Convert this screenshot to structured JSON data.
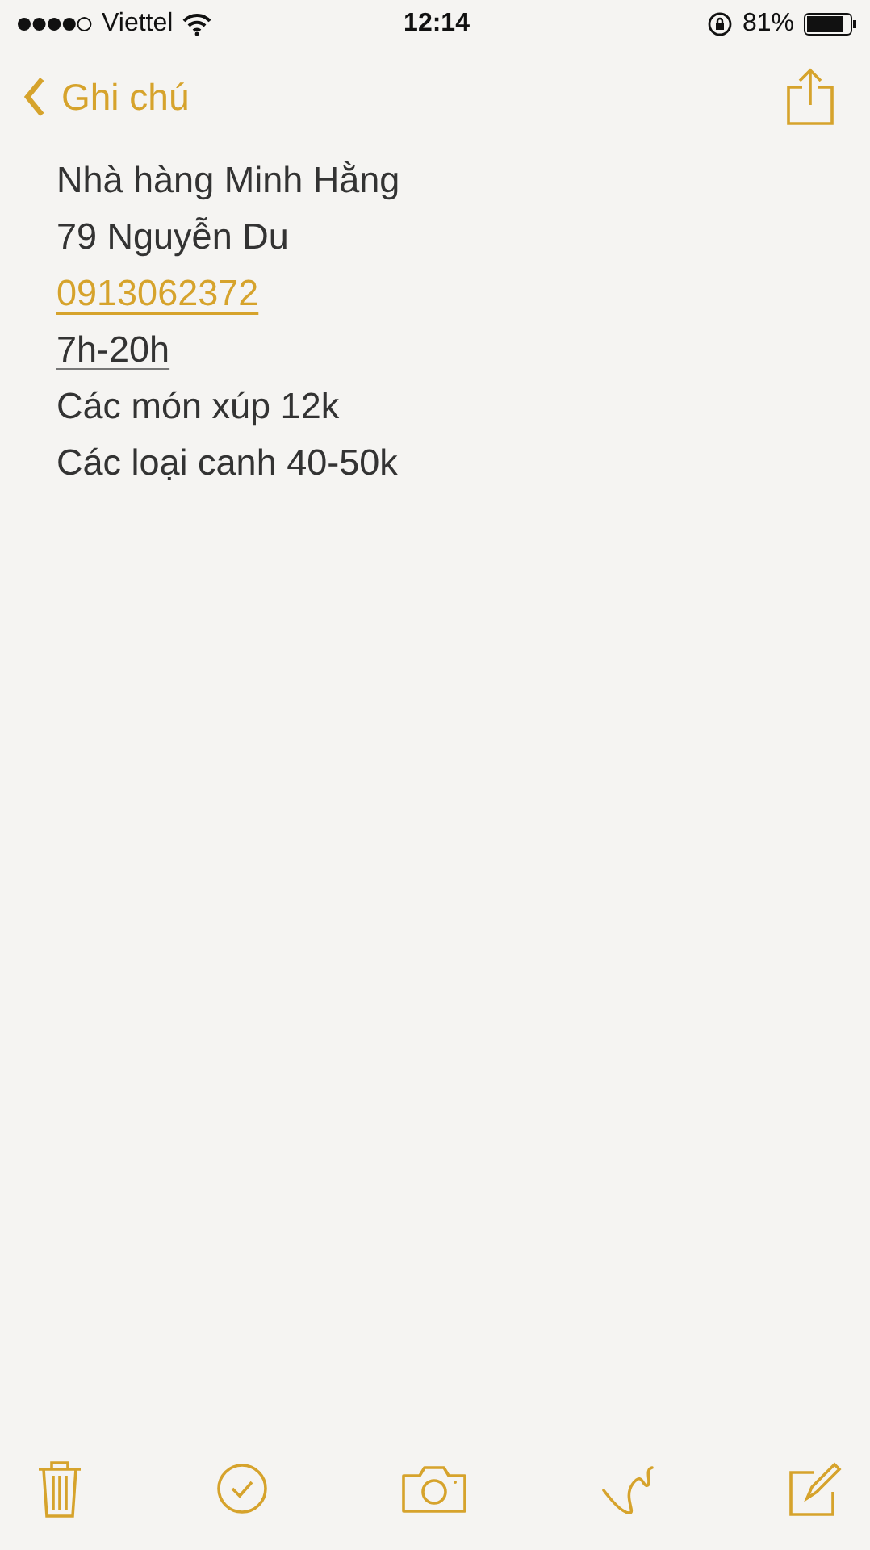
{
  "status_bar": {
    "carrier": "Viettel",
    "time": "12:14",
    "battery": "81%"
  },
  "nav_bar": {
    "back_label": "Ghi chú"
  },
  "note": {
    "lines": [
      {
        "kind": "text",
        "text": "Nhà hàng Minh Hằng"
      },
      {
        "kind": "text",
        "text": "79 Nguyễn Du"
      },
      {
        "kind": "phone",
        "text": "0913062372"
      },
      {
        "kind": "date",
        "text": "7h-20h"
      },
      {
        "kind": "text",
        "text": "Các món xúp 12k"
      },
      {
        "kind": "text",
        "text": "Các loại canh 40-50k"
      }
    ]
  }
}
